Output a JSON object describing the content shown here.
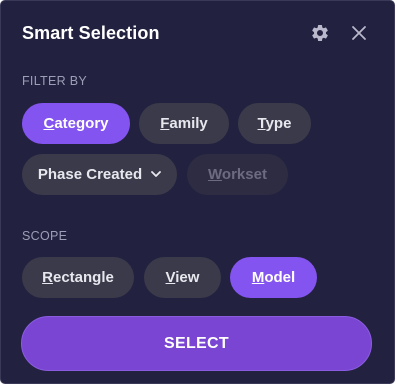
{
  "panel": {
    "title": "Smart Selection",
    "settings_icon": "gear-icon",
    "close_icon": "close-icon"
  },
  "filter": {
    "label": "FILTER BY",
    "chips": [
      {
        "first": "C",
        "rest": "ategory",
        "state": "active"
      },
      {
        "first": "F",
        "rest": "amily",
        "state": "normal"
      },
      {
        "first": "T",
        "rest": "ype",
        "state": "normal"
      },
      {
        "text": "Phase Created",
        "state": "normal",
        "icon": "chevron-down-icon"
      },
      {
        "first": "W",
        "rest": "orkset",
        "state": "disabled"
      }
    ]
  },
  "scope": {
    "label": "SCOPE",
    "chips": [
      {
        "first": "R",
        "rest": "ectangle",
        "state": "normal"
      },
      {
        "first": "V",
        "rest": "iew",
        "state": "normal"
      },
      {
        "first": "M",
        "rest": "odel",
        "state": "active"
      }
    ]
  },
  "actions": {
    "select_label": "SELECT"
  },
  "colors": {
    "panel_bg": "#22213f",
    "chip_bg": "#3b3a4a",
    "chip_active": "#8454f0",
    "chip_disabled": "#2d2c42",
    "select_button": "#7a45d2"
  }
}
